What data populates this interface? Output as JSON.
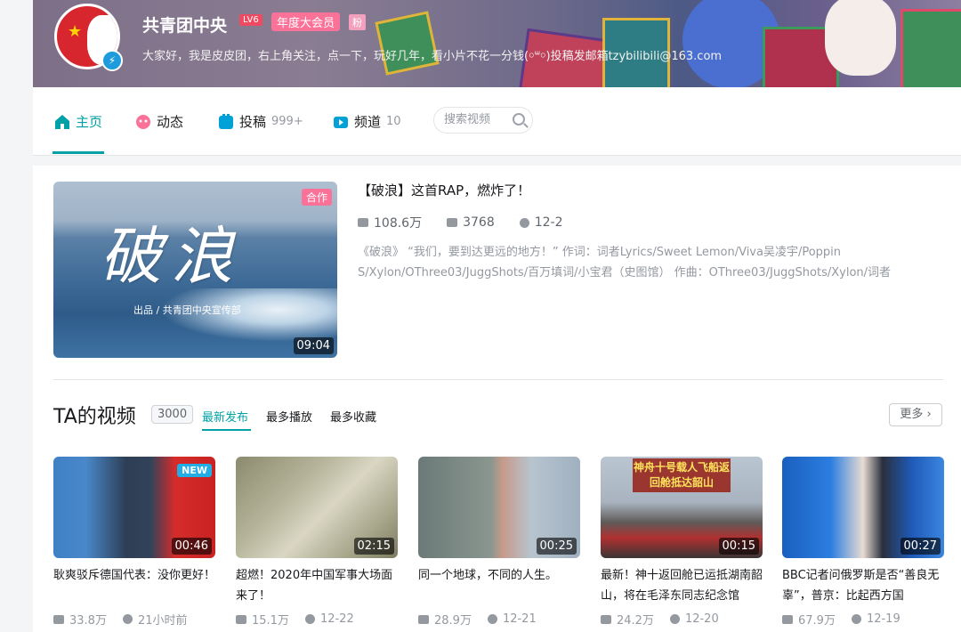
{
  "header": {
    "username": "共青团中央",
    "level": "LV6",
    "vip_badge": "年度大会员",
    "fan_badge": "粉",
    "signature": "大家好，我是皮皮团，右上角关注，点一下，玩好几年，看小片不花一分钱(￮ᐜ￮)投稿发邮箱tzybilibili@163.com"
  },
  "nav": {
    "home": "主页",
    "dynamic": "动态",
    "uploads": "投稿",
    "uploads_count": "999+",
    "channels": "频道",
    "channels_count": "10",
    "search_placeholder": "搜索视频"
  },
  "featured": {
    "thumb_text": "破浪",
    "thumb_credit": "出品 / 共青团中央宣传部",
    "collab_badge": "合作",
    "duration": "09:04",
    "title": "【破浪】这首RAP，燃炸了！",
    "plays": "108.6万",
    "danmaku": "3768",
    "date": "12-2",
    "description": "《破浪》 “我们，要到达更远的地方！” 作词：词者Lyrics/Sweet Lemon/Viva吴凌宇/Poppin S/Xylon/OThree03/JuggShots/百万填词/小宝君（史图馆） 作曲：OThree03/JuggShots/Xylon/词者"
  },
  "videos_section": {
    "title": "TA的视频",
    "count": "3000",
    "tabs": [
      "最新发布",
      "最多播放",
      "最多收藏"
    ],
    "more": "更多"
  },
  "videos": [
    {
      "title": "耿爽驳斥德国代表：没你更好！",
      "duration": "00:46",
      "plays": "33.8万",
      "date": "21小时前",
      "badge": "NEW",
      "overlay": ""
    },
    {
      "title": "超燃！2020年中国军事大场面来了！",
      "duration": "02:15",
      "plays": "15.1万",
      "date": "12-22",
      "badge": "",
      "overlay": ""
    },
    {
      "title": "同一个地球，不同的人生。",
      "duration": "00:25",
      "plays": "28.9万",
      "date": "12-21",
      "badge": "",
      "overlay": ""
    },
    {
      "title": "最新！神十返回舱已运抵湖南韶山，将在毛泽东同志纪念馆",
      "duration": "00:15",
      "plays": "24.2万",
      "date": "12-20",
      "badge": "",
      "overlay": "神舟十号载人飞船返回舱抵达韶山"
    },
    {
      "title": "BBC记者问俄罗斯是否“善良无辜”，普京：比起西方国",
      "duration": "00:27",
      "plays": "67.9万",
      "date": "12-19",
      "badge": "",
      "overlay": ""
    }
  ],
  "colors": {
    "accent": "#00a1a6",
    "pink": "#fb7299",
    "muted": "#9499a0"
  }
}
